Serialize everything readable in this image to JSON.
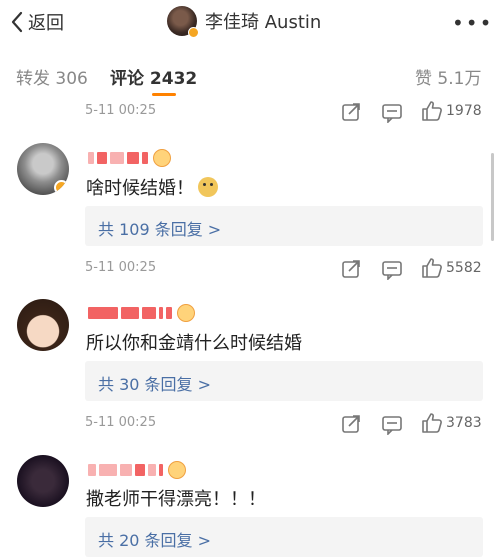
{
  "header": {
    "back_label": "返回",
    "title": "李佳琦 Austin",
    "more": "•••"
  },
  "tabs": {
    "repost": "转发 306",
    "comment": "评论 2432",
    "likes": "赞 5.1万"
  },
  "colors": {
    "accent": "#ff8200",
    "link": "#4a6fa5",
    "name_mask": "#f04848",
    "verified": "#f5a623"
  },
  "top_row": {
    "time": "5-11 00:25",
    "like_count": "1978"
  },
  "comments": [
    {
      "text": "啥时候结婚！",
      "has_emoji": "doge-emoji",
      "replies": "共 109 条回复 >",
      "time": "5-11 00:25",
      "like_count": "5582"
    },
    {
      "text": "所以你和金靖什么时候结婚",
      "replies": "共 30 条回复 >",
      "time": "5-11 00:25",
      "like_count": "3783"
    },
    {
      "text": "撒老师干得漂亮！！！",
      "replies": "共 20 条回复 >"
    }
  ]
}
